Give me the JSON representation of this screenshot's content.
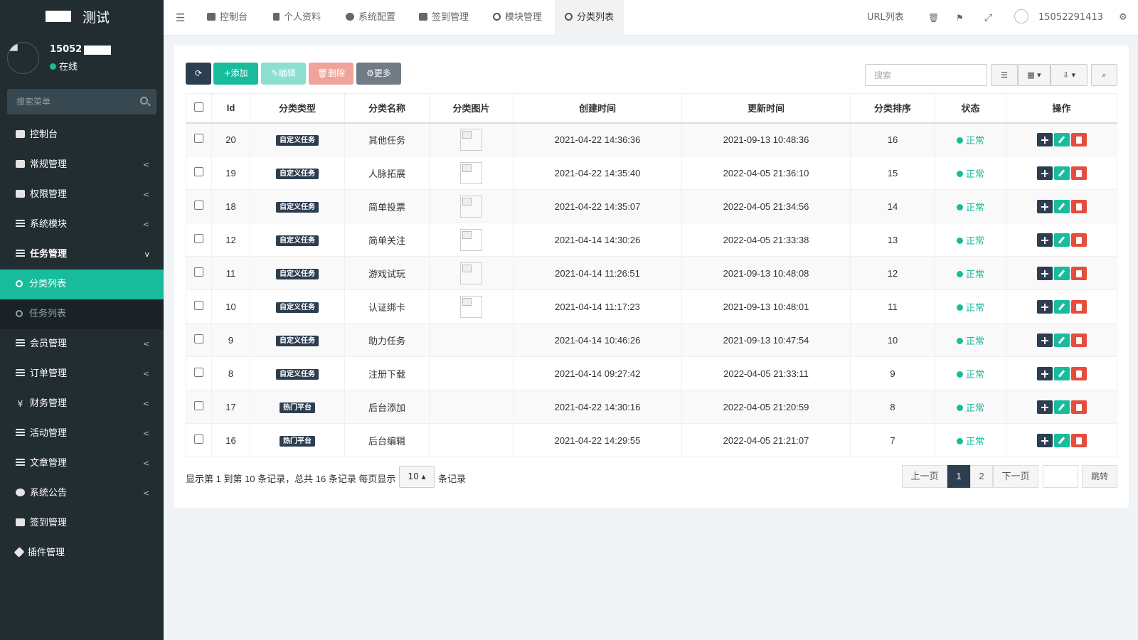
{
  "sidebar": {
    "brand": "测试",
    "user_name": "15052",
    "status": "在线",
    "search_placeholder": "搜索菜单",
    "items": [
      {
        "label": "控制台"
      },
      {
        "label": "常规管理"
      },
      {
        "label": "权限管理"
      },
      {
        "label": "系统模块"
      },
      {
        "label": "任务管理"
      },
      {
        "label": "分类列表"
      },
      {
        "label": "任务列表"
      },
      {
        "label": "会员管理"
      },
      {
        "label": "订单管理"
      },
      {
        "label": "财务管理"
      },
      {
        "label": "活动管理"
      },
      {
        "label": "文章管理"
      },
      {
        "label": "系统公告"
      },
      {
        "label": "签到管理"
      },
      {
        "label": "插件管理"
      }
    ]
  },
  "topbar": {
    "tabs": [
      "控制台",
      "个人资料",
      "系统配置",
      "签到管理",
      "模块管理",
      "分类列表"
    ],
    "url_list": "URL列表",
    "username": "15052291413"
  },
  "toolbar": {
    "add": "添加",
    "edit": "编辑",
    "delete": "删除",
    "more": "更多",
    "search_placeholder": "搜索"
  },
  "table": {
    "headers": [
      "Id",
      "分类类型",
      "分类名称",
      "分类图片",
      "创建时间",
      "更新时间",
      "分类排序",
      "状态",
      "操作"
    ],
    "rows": [
      {
        "id": "20",
        "type": "自定义任务",
        "name": "其他任务",
        "img": true,
        "created": "2021-04-22 14:36:36",
        "updated": "2021-09-13 10:48:36",
        "sort": "16",
        "status": "正常"
      },
      {
        "id": "19",
        "type": "自定义任务",
        "name": "人脉拓展",
        "img": true,
        "created": "2021-04-22 14:35:40",
        "updated": "2022-04-05 21:36:10",
        "sort": "15",
        "status": "正常"
      },
      {
        "id": "18",
        "type": "自定义任务",
        "name": "简单投票",
        "img": true,
        "created": "2021-04-22 14:35:07",
        "updated": "2022-04-05 21:34:56",
        "sort": "14",
        "status": "正常"
      },
      {
        "id": "12",
        "type": "自定义任务",
        "name": "简单关注",
        "img": true,
        "created": "2021-04-14 14:30:26",
        "updated": "2022-04-05 21:33:38",
        "sort": "13",
        "status": "正常"
      },
      {
        "id": "11",
        "type": "自定义任务",
        "name": "游戏试玩",
        "img": true,
        "created": "2021-04-14 11:26:51",
        "updated": "2021-09-13 10:48:08",
        "sort": "12",
        "status": "正常"
      },
      {
        "id": "10",
        "type": "自定义任务",
        "name": "认证绑卡",
        "img": true,
        "created": "2021-04-14 11:17:23",
        "updated": "2021-09-13 10:48:01",
        "sort": "11",
        "status": "正常"
      },
      {
        "id": "9",
        "type": "自定义任务",
        "name": "助力任务",
        "img": false,
        "created": "2021-04-14 10:46:26",
        "updated": "2021-09-13 10:47:54",
        "sort": "10",
        "status": "正常"
      },
      {
        "id": "8",
        "type": "自定义任务",
        "name": "注册下载",
        "img": false,
        "created": "2021-04-14 09:27:42",
        "updated": "2022-04-05 21:33:11",
        "sort": "9",
        "status": "正常"
      },
      {
        "id": "17",
        "type": "热门平台",
        "name": "后台添加",
        "img": false,
        "created": "2021-04-22 14:30:16",
        "updated": "2022-04-05 21:20:59",
        "sort": "8",
        "status": "正常"
      },
      {
        "id": "16",
        "type": "热门平台",
        "name": "后台编辑",
        "img": false,
        "created": "2021-04-22 14:29:55",
        "updated": "2022-04-05 21:21:07",
        "sort": "7",
        "status": "正常"
      }
    ]
  },
  "pagination": {
    "info_before": "显示第 1 到第 10 条记录，总共 16 条记录 每页显示",
    "page_size": "10",
    "info_after": "条记录",
    "prev": "上一页",
    "pages": [
      "1",
      "2"
    ],
    "next": "下一页",
    "jump": "跳转"
  },
  "colors": {
    "sidebar_bg": "#222d32",
    "accent": "#18bc9c",
    "primary": "#2c3e50",
    "danger": "#e74c3c"
  }
}
